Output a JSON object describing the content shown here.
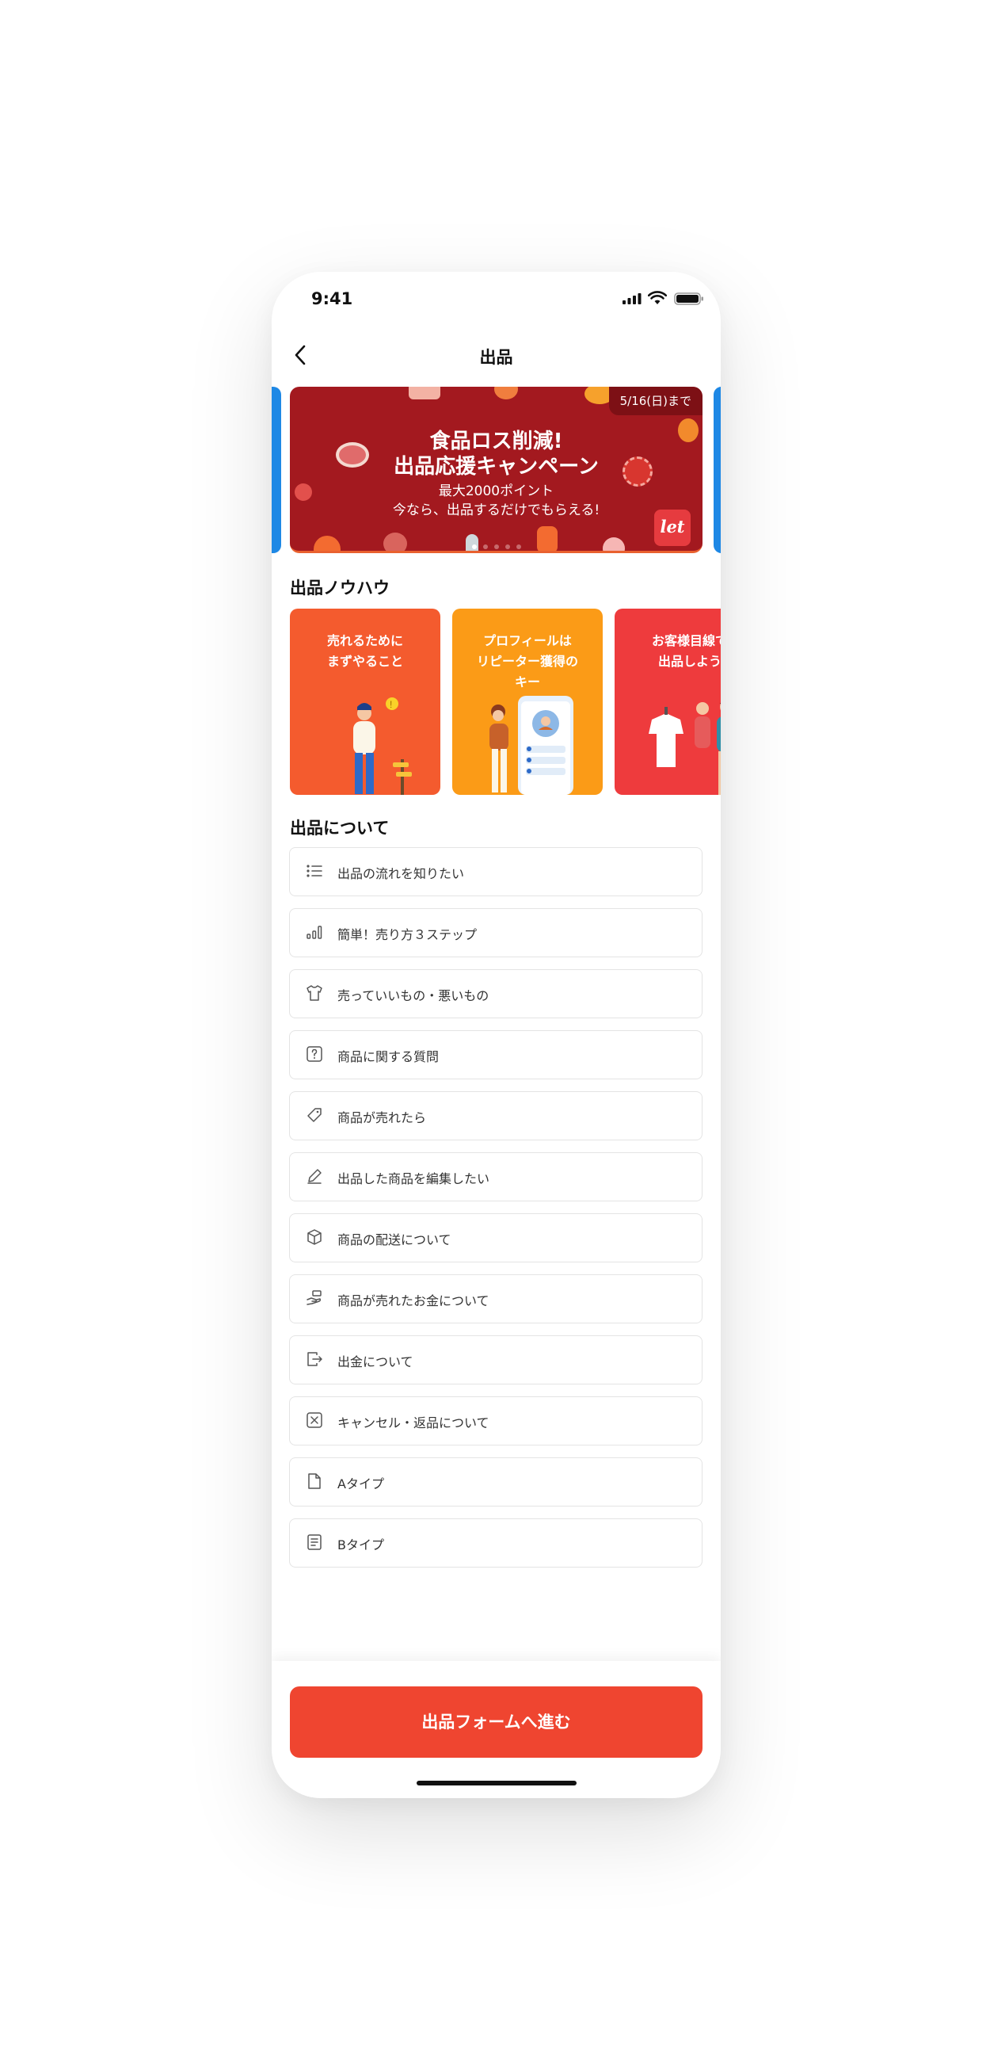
{
  "status_bar": {
    "time": "9:41",
    "icons": [
      "signal-icon",
      "wifi-icon",
      "battery-icon"
    ]
  },
  "header": {
    "title": "出品",
    "back_icon": "chevron-left-icon"
  },
  "banner": {
    "date_badge": "5/16(日)まで",
    "headline_1": "食品ロス削減!",
    "headline_2": "出品応援キャンペーン",
    "sub_1": "最大2000ポイント",
    "sub_2": "今なら、出品するだけでもらえる!",
    "logo_text": "let",
    "background_color": "#a3191f",
    "indicator_count": 5,
    "indicator_active": 0
  },
  "knowhow": {
    "heading": "出品ノウハウ",
    "cards": [
      {
        "title": "売れるために\nまずやること",
        "color": "#f45b2e"
      },
      {
        "title": "プロフィールは\nリピーター獲得の\nキー",
        "color": "#fb9b17"
      },
      {
        "title": "お客様目線で\n出品しよう",
        "color": "#ee3b3d"
      }
    ]
  },
  "about": {
    "heading": "出品について",
    "items": [
      {
        "label": "出品の流れを知りたい",
        "icon": "list-icon"
      },
      {
        "label": "簡単！売り方３ステップ",
        "icon": "bar-chart-icon"
      },
      {
        "label": "売っていいもの・悪いもの",
        "icon": "tshirt-icon"
      },
      {
        "label": "商品に関する質問",
        "icon": "question-icon"
      },
      {
        "label": "商品が売れたら",
        "icon": "tag-icon"
      },
      {
        "label": "出品した商品を編集したい",
        "icon": "pencil-icon"
      },
      {
        "label": "商品の配送について",
        "icon": "box-icon"
      },
      {
        "label": "商品が売れたお金について",
        "icon": "hand-money-icon"
      },
      {
        "label": "出金について",
        "icon": "exit-icon"
      },
      {
        "label": "キャンセル・返品について",
        "icon": "close-square-icon"
      },
      {
        "label": "Aタイプ",
        "icon": "file-icon"
      },
      {
        "label": "Bタイプ",
        "icon": "document-icon"
      }
    ]
  },
  "footer": {
    "cta_label": "出品フォームへ進む",
    "cta_color": "#ef4530"
  }
}
